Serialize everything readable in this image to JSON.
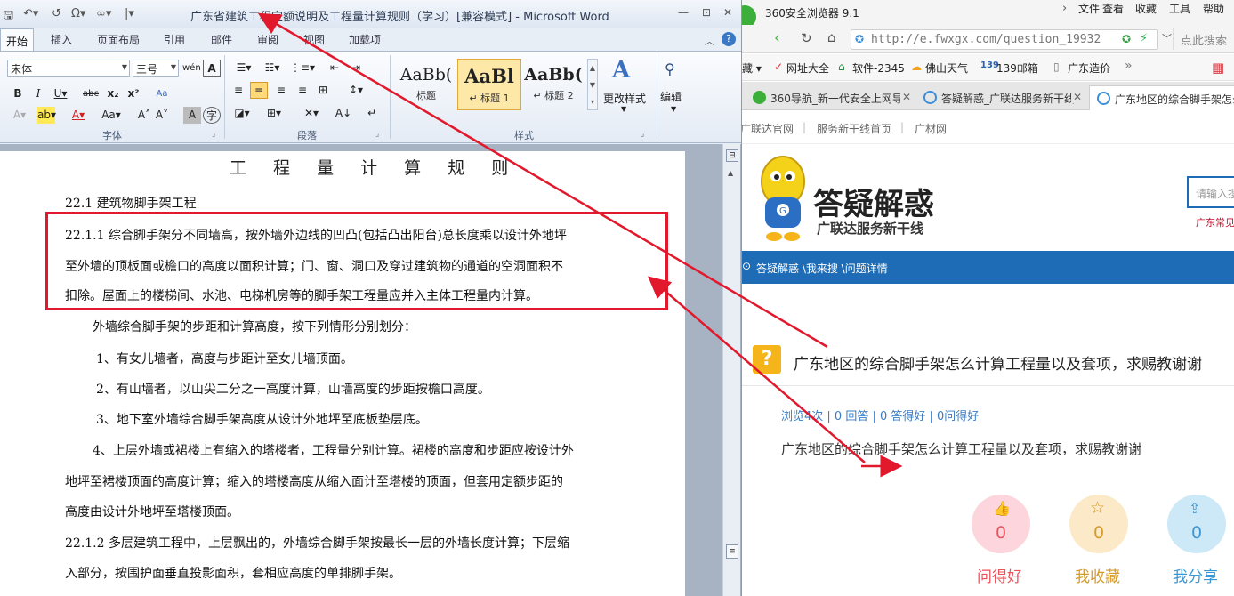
{
  "word": {
    "title": "广东省建筑工程定额说明及工程量计算规则（学习）[兼容模式] - Microsoft Word",
    "qat": [
      "🖫",
      "↶▾",
      "↺",
      "Ω▾",
      "∞▾",
      "|▾"
    ],
    "window_controls": [
      "—",
      "⊡",
      "✕"
    ],
    "tabs": [
      "开始",
      "插入",
      "页面布局",
      "引用",
      "邮件",
      "审阅",
      "视图",
      "加载项"
    ],
    "font": {
      "name": "宋体",
      "size": "三号",
      "group_label": "字体",
      "buttons_row1": [
        "wén",
        "A"
      ],
      "buttons_row2": [
        "B",
        "I",
        "U▾",
        "abc",
        "x₂",
        "x²",
        "Aa"
      ],
      "buttons_row3": [
        "A▾",
        "ab▾",
        "A▾",
        "Aa▾",
        "A˄",
        "A˅",
        "A",
        "字"
      ]
    },
    "paragraph": {
      "group_label": "段落",
      "row1": [
        "☰▾",
        "☷▾",
        "⋮≡▾",
        "⇤",
        "⇥"
      ],
      "row2": [
        "≡",
        "≡",
        "≡",
        "≡",
        "⊞",
        "↕▾"
      ],
      "row3": [
        "◪▾",
        "⊞▾",
        "✕▾",
        "A↓",
        "↵"
      ]
    },
    "styles": {
      "group_label": "样式",
      "items": [
        {
          "sample": "AaBb(",
          "name": "标题"
        },
        {
          "sample": "AaBl",
          "name": "↵ 标题 1"
        },
        {
          "sample": "AaBb(",
          "name": "↵ 标题 2"
        }
      ],
      "change_styles": "更改样式",
      "edit": "编辑"
    },
    "document": {
      "title": "工 程 量 计 算 规 则",
      "lines": [
        "22.1 建筑物脚手架工程",
        "22.1.1 综合脚手架分不同墙高，按外墙外边线的凹凸(包括凸出阳台)总长度乘以设计外地坪",
        "至外墙的顶板面或檐口的高度以面积计算；门、窗、洞口及穿过建筑物的通道的空洞面积不",
        "扣除。屋面上的楼梯间、水池、电梯机房等的脚手架工程量应并入主体工程量内计算。",
        "外墙综合脚手架的步距和计算高度，按下列情形分别划分：",
        "1、有女儿墙者，高度与步距计至女儿墙顶面。",
        "2、有山墙者，以山尖二分之一高度计算，山墙高度的步距按檐口高度。",
        "3、地下室外墙综合脚手架高度从设计外地坪至底板垫层底。",
        "4、上层外墙或裙楼上有缩入的塔楼者，工程量分别计算。裙楼的高度和步距应按设计外",
        "地坪至裙楼顶面的高度计算；缩入的塔楼高度从缩入面计至塔楼的顶面，但套用定额步距的",
        "高度由设计外地坪至塔楼顶面。",
        "22.1.2 多层建筑工程中，上层飘出的，外墙综合脚手架按最长一层的外墙长度计算；下层缩",
        "入部分，按围护面垂直投影面积，套相应高度的单排脚手架。"
      ]
    }
  },
  "browser": {
    "title": "360安全浏览器 9.1",
    "menu": [
      "›",
      "文件",
      "查看",
      "收藏",
      "工具",
      "帮助"
    ],
    "nav_buttons": [
      "‹",
      "↻",
      "⌂"
    ],
    "url": "http://e.fwxgx.com/question_19932",
    "search_placeholder": "点此搜索",
    "bookmarks": [
      "藏 ▾",
      "网址大全",
      "软件-2345",
      "佛山天气",
      "139邮箱",
      "广东造价",
      "»"
    ],
    "tabs": [
      {
        "label": "360导航_新一代安全上网导",
        "active": false
      },
      {
        "label": "答疑解惑_广联达服务新干线",
        "active": false
      },
      {
        "label": "广东地区的综合脚手架怎么",
        "active": true
      }
    ],
    "site": {
      "top_links": [
        "广联达官网",
        "服务新干线首页",
        "广材网"
      ],
      "logo_title": "答疑解惑",
      "logo_subtitle": "广联达服务新干线",
      "search_placeholder": "请输入搜",
      "search_hint": "广东常见",
      "breadcrumb": "答疑解惑 \\我来搜 \\问题详情",
      "question_mark": "?",
      "question_title": "广东地区的综合脚手架怎么计算工程量以及套项，求赐教谢谢",
      "stats": "浏览4次 | 0 回答 | 0 答得好 | 0问得好",
      "question_body": "广东地区的综合脚手架怎么计算工程量以及套项，求赐教谢谢",
      "actions": [
        {
          "icon": "👍",
          "count": "0",
          "label": "问得好"
        },
        {
          "icon": "☆",
          "count": "0",
          "label": "我收藏"
        },
        {
          "icon": "⇪",
          "count": "0",
          "label": "我分享"
        }
      ]
    }
  },
  "colors": {
    "annotation": "#e2182c",
    "site_nav": "#1f6cb6",
    "good": "#e9525a",
    "collect": "#d49a2a",
    "share": "#3b97d3"
  }
}
